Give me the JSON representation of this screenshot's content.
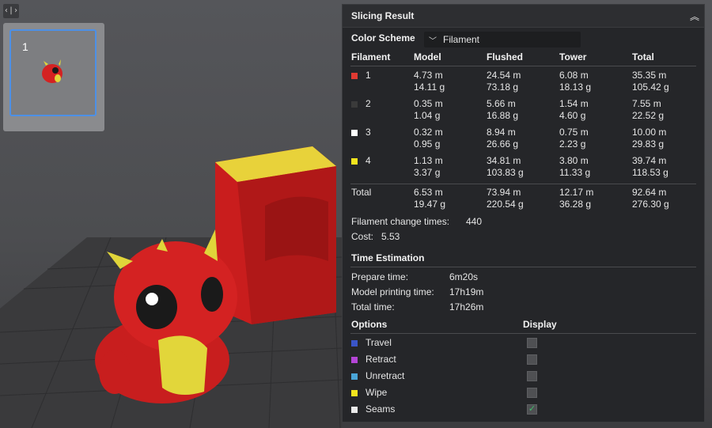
{
  "plate": {
    "number": "1"
  },
  "panel": {
    "title": "Slicing Result",
    "color_scheme_label": "Color Scheme",
    "color_scheme_value": "Filament",
    "columns": [
      "Filament",
      "Model",
      "Flushed",
      "Tower",
      "Total"
    ],
    "filaments": [
      {
        "id": "1",
        "color": "#e03a32",
        "model": [
          "4.73 m",
          "14.11 g"
        ],
        "flushed": [
          "24.54 m",
          "73.18 g"
        ],
        "tower": [
          "6.08 m",
          "18.13 g"
        ],
        "total": [
          "35.35 m",
          "105.42 g"
        ]
      },
      {
        "id": "2",
        "color": "#3a3a3a",
        "model": [
          "0.35 m",
          "1.04 g"
        ],
        "flushed": [
          "5.66 m",
          "16.88 g"
        ],
        "tower": [
          "1.54 m",
          "4.60 g"
        ],
        "total": [
          "7.55 m",
          "22.52 g"
        ]
      },
      {
        "id": "3",
        "color": "#ffffff",
        "model": [
          "0.32 m",
          "0.95 g"
        ],
        "flushed": [
          "8.94 m",
          "26.66 g"
        ],
        "tower": [
          "0.75 m",
          "2.23 g"
        ],
        "total": [
          "10.00 m",
          "29.83 g"
        ]
      },
      {
        "id": "4",
        "color": "#f2e41e",
        "model": [
          "1.13 m",
          "3.37 g"
        ],
        "flushed": [
          "34.81 m",
          "103.83 g"
        ],
        "tower": [
          "3.80 m",
          "11.33 g"
        ],
        "total": [
          "39.74 m",
          "118.53 g"
        ]
      }
    ],
    "total_row": {
      "label": "Total",
      "model": [
        "6.53 m",
        "19.47 g"
      ],
      "flushed": [
        "73.94 m",
        "220.54 g"
      ],
      "tower": [
        "12.17 m",
        "36.28 g"
      ],
      "total": [
        "92.64 m",
        "276.30 g"
      ]
    },
    "filament_change_label": "Filament change times:",
    "filament_change_value": "440",
    "cost_label": "Cost:",
    "cost_value": "5.53",
    "time_title": "Time Estimation",
    "prepare_label": "Prepare time:",
    "prepare_value": "6m20s",
    "printing_label": "Model printing time:",
    "printing_value": "17h19m",
    "total_time_label": "Total time:",
    "total_time_value": "17h26m",
    "options_label": "Options",
    "display_label": "Display",
    "options": [
      {
        "label": "Travel",
        "color": "#3a55c8",
        "checked": false
      },
      {
        "label": "Retract",
        "color": "#b445d6",
        "checked": false
      },
      {
        "label": "Unretract",
        "color": "#4aa6d8",
        "checked": false
      },
      {
        "label": "Wipe",
        "color": "#f2e41e",
        "checked": false
      },
      {
        "label": "Seams",
        "color": "#eaeaea",
        "checked": true
      }
    ]
  }
}
